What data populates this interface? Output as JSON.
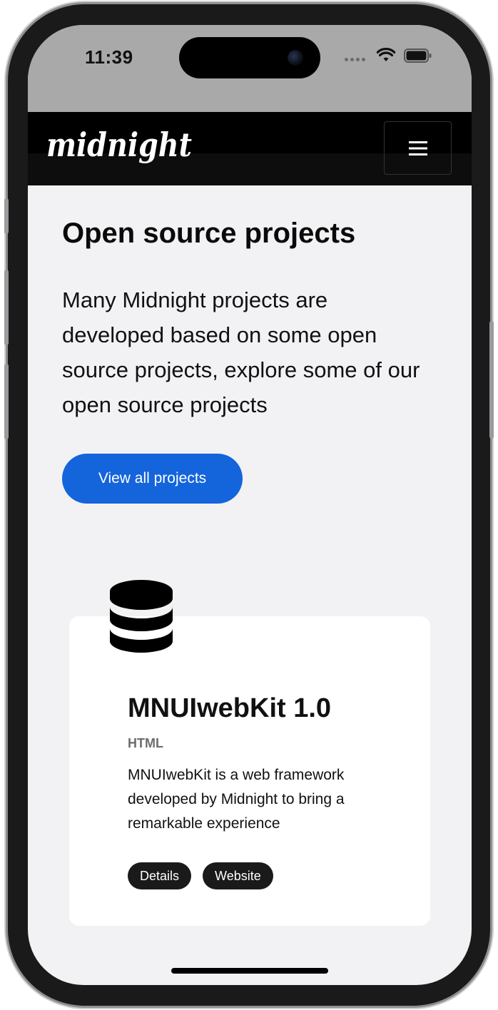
{
  "status_bar": {
    "time": "11:39"
  },
  "navbar": {
    "brand": "midnight",
    "menu_icon": "hamburger-menu-icon"
  },
  "hero": {
    "title": "Open source projects",
    "description": "Many Midnight projects are developed based on some open source projects, explore some of our open source projects",
    "button_label": "View all projects"
  },
  "project_card": {
    "icon": "database-icon",
    "title": "MNUIwebKit 1.0",
    "tag": "HTML",
    "description": "MNUIwebKit is a web framework developed by Midnight to bring a remarkable experience",
    "actions": [
      "Details",
      "Website"
    ]
  },
  "colors": {
    "accent_blue": "#1464dc",
    "navbar_bg": "#000000",
    "page_bg": "#f2f2f4",
    "chip_bg": "#1a1a1a"
  }
}
